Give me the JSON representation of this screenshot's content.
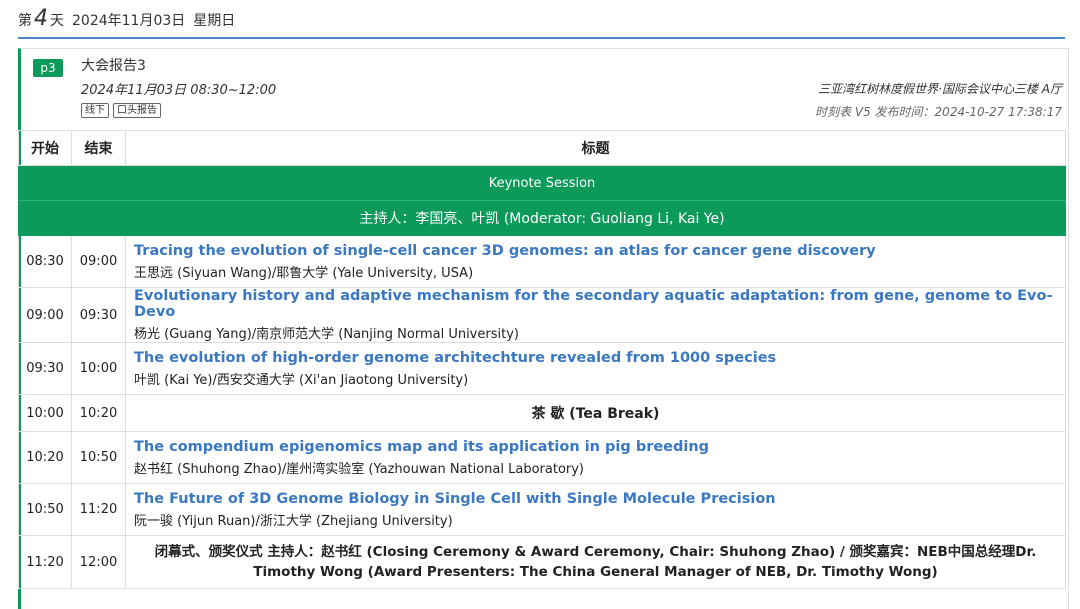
{
  "day": {
    "prefix": "第",
    "number": "4",
    "suffix": "天",
    "date": "2024年11月03日",
    "weekday": "星期日"
  },
  "session": {
    "code": "p3",
    "title": "大会报告3",
    "time": "2024年11月03日 08:30~12:00",
    "tags": [
      "线下",
      "口头报告"
    ],
    "venue": "三亚湾红树林度假世界·国际会议中心三楼 A厅",
    "version": "时刻表 V5 发布时间：2024-10-27 17:38:17"
  },
  "table": {
    "headers": {
      "start": "开始",
      "end": "结束",
      "title": "标题"
    },
    "keynote": "Keynote Session",
    "moderator": "主持人：李国亮、叶凯 (Moderator: Guoliang Li, Kai Ye)",
    "rows": [
      {
        "start": "08:30",
        "end": "09:00",
        "title": "Tracing the evolution of single-cell cancer 3D genomes: an atlas for cancer gene discovery",
        "speaker": "王思远 (Siyuan Wang)/耶鲁大学 (Yale University, USA)"
      },
      {
        "start": "09:00",
        "end": "09:30",
        "title": "Evolutionary history and adaptive mechanism for the secondary aquatic adaptation: from gene, genome to Evo-Devo",
        "speaker": "杨光 (Guang Yang)/南京师范大学 (Nanjing Normal University)"
      },
      {
        "start": "09:30",
        "end": "10:00",
        "title": "The evolution of high-order genome architechture revealed from 1000 species",
        "speaker": "叶凯 (Kai Ye)/西安交通大学 (Xi'an Jiaotong University)"
      },
      {
        "start": "10:00",
        "end": "10:20",
        "break": "茶 歇 (Tea Break)"
      },
      {
        "start": "10:20",
        "end": "10:50",
        "title": "The compendium epigenomics map and its application in pig breeding",
        "speaker": "赵书红 (Shuhong Zhao)/崖州湾实验室 (Yazhouwan National Laboratory)"
      },
      {
        "start": "10:50",
        "end": "11:20",
        "title": "The Future of 3D Genome Biology in Single Cell with Single Molecule Precision",
        "speaker": "阮一骏 (Yijun Ruan)/浙江大学 (Zhejiang University)"
      },
      {
        "start": "11:20",
        "end": "12:00",
        "closing": "闭幕式、颁奖仪式 主持人：赵书红 (Closing Ceremony & Award Ceremony, Chair: Shuhong Zhao) / 颁奖嘉宾：NEB中国总经理Dr. Timothy Wong (Award Presenters: The China General Manager of NEB, Dr. Timothy Wong)"
      }
    ]
  }
}
